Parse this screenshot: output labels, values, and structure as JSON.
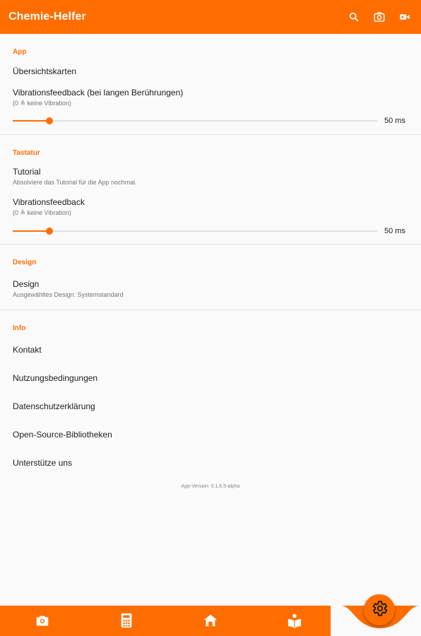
{
  "appbar": {
    "title": "Chemie-Helfer",
    "actions": [
      {
        "icon": "search-icon"
      },
      {
        "icon": "camera-switch-icon"
      },
      {
        "icon": "video-camera-icon"
      }
    ]
  },
  "colors": {
    "accent": "#ff6d00",
    "background": "#fafafa"
  },
  "sections": {
    "app": {
      "title": "App",
      "overview_cards": "Übersichtskarten",
      "vibration": {
        "title": "Vibrationsfeedback (bei langen Berührungen)",
        "summary": "(0 ≙ keine Vibration)",
        "value": "50 ms",
        "level": 0.1
      }
    },
    "keyboard": {
      "title": "Tastatur",
      "tutorial": {
        "title": "Tutorial",
        "summary": "Absolviere das Tutorial für die App nochmal."
      },
      "vibration": {
        "title": "Vibrationsfeedback",
        "summary": "(0 ≙ keine Vibration)",
        "value": "50 ms",
        "level": 0.1
      }
    },
    "design": {
      "title": "Design",
      "design": {
        "title": "Design",
        "summary": "Ausgewähltes Design: Systemstandard"
      }
    },
    "info": {
      "title": "Info",
      "items": [
        "Kontakt",
        "Nutzungsbedingungen",
        "Datenschutzerklärung",
        "Open-Source-Bibliotheken",
        "Unterstütze uns"
      ]
    }
  },
  "version": "App-Version: 0.1.6.5-alpha",
  "bottom_nav": {
    "items": [
      {
        "icon": "camera-icon"
      },
      {
        "icon": "calculator-icon"
      },
      {
        "icon": "home-icon"
      },
      {
        "icon": "book-reader-icon"
      }
    ],
    "fab_icon": "settings-gear-icon"
  }
}
